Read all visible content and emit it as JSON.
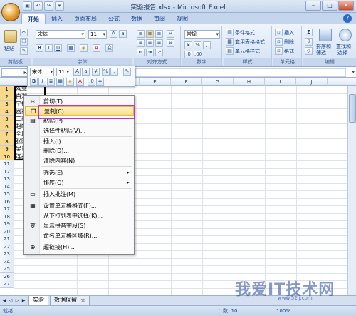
{
  "window": {
    "title": "实验报告.xlsx - Microsoft Excel"
  },
  "tabs": [
    "开始",
    "插入",
    "页面布局",
    "公式",
    "数据",
    "审阅",
    "视图"
  ],
  "ribbon": {
    "clipboard": {
      "paste": "粘贴",
      "label": "剪贴板"
    },
    "font": {
      "name": "宋体",
      "size": "11",
      "label": "字体"
    },
    "alignment": {
      "label": "对齐方式"
    },
    "number": {
      "format": "常规",
      "label": "数字"
    },
    "styles": {
      "cond": "条件格式",
      "table": "套用表格格式",
      "cell": "单元格样式",
      "label": "样式"
    },
    "cells": {
      "insert": "插入",
      "delete": "删除",
      "format": "格式",
      "label": "单元格"
    },
    "editing": {
      "sort": "排序和",
      "filter": "筛选",
      "find": "查找和",
      "select": "选择",
      "label": "编辑"
    }
  },
  "formula_bar": {
    "name_box": "R1"
  },
  "mini_toolbar": {
    "font": "宋体",
    "size": "11"
  },
  "columns": [
    "A",
    "B",
    "C",
    "D",
    "E",
    "F",
    "G",
    "H",
    "I",
    "J"
  ],
  "rows": [
    "1",
    "2",
    "3",
    "4",
    "5",
    "6",
    "7",
    "8",
    "9",
    "10",
    "11",
    "12",
    "13",
    "14",
    "15",
    "16",
    "17",
    "18",
    "19",
    "20",
    "21",
    "22",
    "23",
    "24",
    "25",
    "26",
    "27"
  ],
  "cells_a": [
    "欧菲",
    "白潮",
    "宁招",
    "凼高",
    "二高",
    "赵畦",
    "全珠",
    "张阿",
    "吴贵",
    "连品"
  ],
  "context_menu": {
    "items": [
      {
        "label": "剪切(T)",
        "icon": "scissors-icon",
        "glyph": "✂"
      },
      {
        "label": "复制(C)",
        "icon": "copy-icon",
        "glyph": "❐"
      },
      {
        "label": "粘贴(P)",
        "icon": "paste-icon",
        "glyph": "▤"
      },
      {
        "label": "选择性粘贴(V)...",
        "icon": "",
        "glyph": ""
      },
      {
        "label": "插入(I)...",
        "icon": "",
        "glyph": ""
      },
      {
        "label": "删除(D)...",
        "icon": "",
        "glyph": ""
      },
      {
        "label": "清除内容(N)",
        "icon": "",
        "glyph": ""
      },
      {
        "label": "筛选(E)",
        "icon": "",
        "glyph": ""
      },
      {
        "label": "排序(O)",
        "icon": "",
        "glyph": ""
      },
      {
        "label": "插入批注(M)",
        "icon": "comment-icon",
        "glyph": "▭"
      },
      {
        "label": "设置单元格格式(F)...",
        "icon": "format-cells-icon",
        "glyph": "▦"
      },
      {
        "label": "从下拉列表中选择(K)...",
        "icon": "",
        "glyph": ""
      },
      {
        "label": "显示拼音字段(S)",
        "icon": "phonetic-icon",
        "glyph": "变"
      },
      {
        "label": "命名单元格区域(R)...",
        "icon": "",
        "glyph": ""
      },
      {
        "label": "超链接(H)...",
        "icon": "hyperlink-icon",
        "glyph": "⊕"
      }
    ]
  },
  "sheets": [
    "实验",
    "数据保留"
  ],
  "status": {
    "mode": "就绪",
    "count": "计数: 10",
    "zoom": "100%"
  },
  "watermark": {
    "main": "我爱IT技术网",
    "sub": "www.52ij.com"
  }
}
